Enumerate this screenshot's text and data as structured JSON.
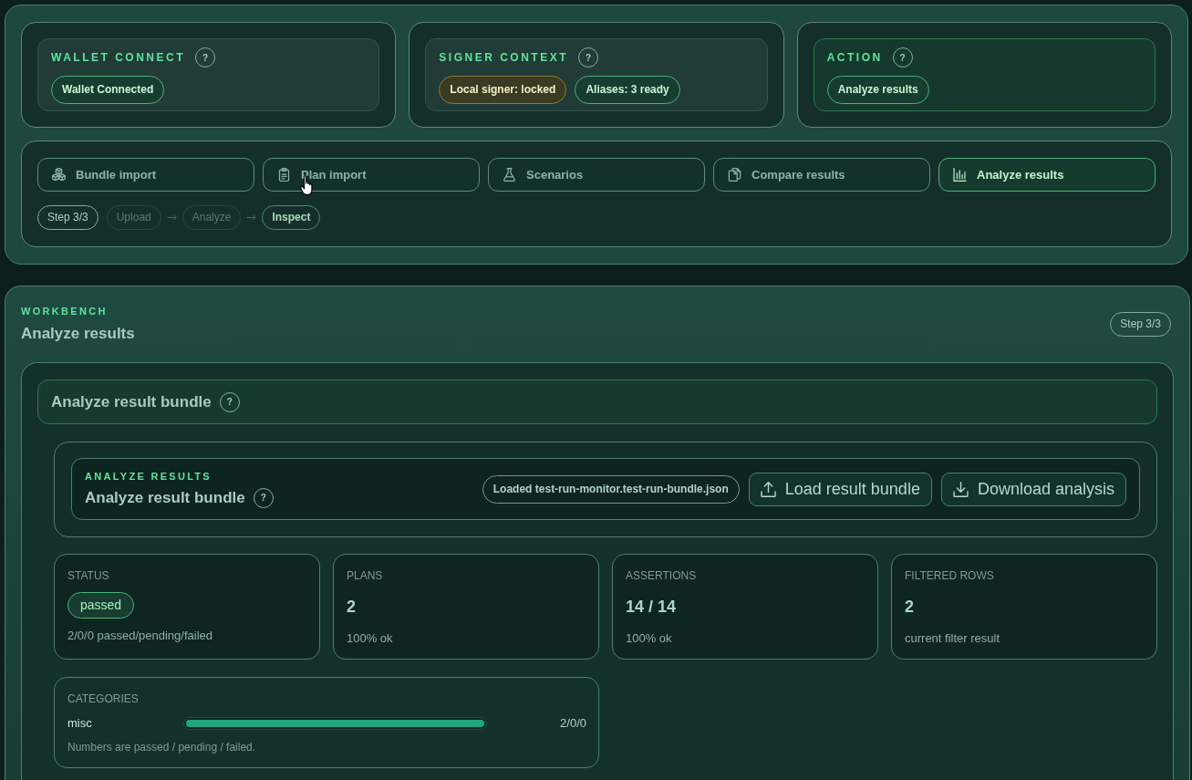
{
  "top_cards": [
    {
      "kind": "status",
      "label": "WALLET CONNECT",
      "help": "?",
      "pills": [
        {
          "text": "Wallet Connected",
          "kind": "success"
        }
      ]
    },
    {
      "kind": "status",
      "label": "SIGNER CONTEXT",
      "help": "?",
      "pills": [
        {
          "text": "Local signer: locked",
          "kind": "warning"
        },
        {
          "text": "Aliases: 3 ready",
          "kind": "success"
        }
      ]
    },
    {
      "kind": "action",
      "label": "ACTION",
      "help": "?",
      "pills": [
        {
          "text": "Analyze results",
          "kind": "success"
        }
      ]
    }
  ],
  "tabs": [
    {
      "label": "Bundle import",
      "selected": false
    },
    {
      "label": "Plan import",
      "selected": false
    },
    {
      "label": "Scenarios",
      "selected": false
    },
    {
      "label": "Compare results",
      "selected": false
    },
    {
      "label": "Analyze results",
      "selected": true
    }
  ],
  "steps": {
    "counter": "Step 3/3",
    "items": [
      {
        "label": "Upload",
        "selected": false
      },
      {
        "label": "Analyze",
        "selected": false
      },
      {
        "label": "Inspect",
        "selected": true
      }
    ]
  },
  "workbench": {
    "label": "WORKBENCH",
    "title": "Analyze results",
    "step": "Step 3/3",
    "section": {
      "title": "Analyze result bundle",
      "help": "?"
    },
    "results": {
      "label": "ANALYZE RESULTS",
      "title": "Analyze result bundle",
      "help": "?",
      "file": "Loaded test-run-monitor.test-run-bundle.json",
      "buttons": [
        "Load result bundle",
        "Download analysis"
      ]
    },
    "stats": [
      {
        "kind": "badge",
        "label": "STATUS",
        "badge": "passed",
        "note": "2/0/0 passed/pending/failed"
      },
      {
        "kind": "value",
        "label": "PLANS",
        "value": "2",
        "note": "100% ok"
      },
      {
        "kind": "value",
        "label": "ASSERTIONS",
        "value": "14 / 14",
        "note": "100% ok"
      },
      {
        "kind": "value",
        "label": "FILTERED ROWS",
        "value": "2",
        "note": "current filter result"
      }
    ],
    "categories": {
      "label": "CATEGORIES",
      "rows": [
        {
          "name": "misc",
          "level": 1,
          "counts": "2/0/0"
        }
      ],
      "note": "Numbers are passed / pending / failed."
    }
  }
}
